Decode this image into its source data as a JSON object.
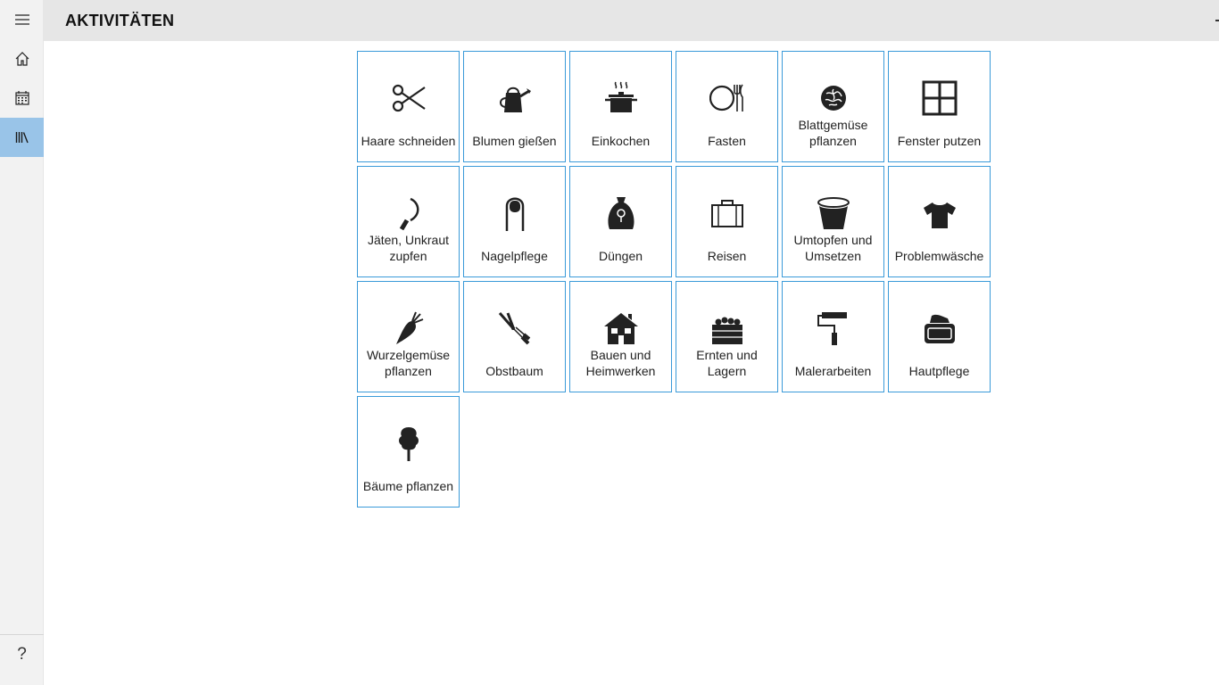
{
  "header": {
    "title": "AKTIVITÄTEN"
  },
  "nav": {
    "items": [
      {
        "name": "menu-icon"
      },
      {
        "name": "home-icon"
      },
      {
        "name": "calendar-icon"
      },
      {
        "name": "library-icon",
        "active": true
      }
    ],
    "help_label": "?"
  },
  "activities": [
    {
      "label": "Haare schneiden",
      "icon": "scissors-icon"
    },
    {
      "label": "Blumen gießen",
      "icon": "watering-can-icon"
    },
    {
      "label": "Einkochen",
      "icon": "cooking-pot-icon"
    },
    {
      "label": "Fasten",
      "icon": "plate-cutlery-icon"
    },
    {
      "label": "Blattgemüse pflanzen",
      "icon": "lettuce-icon"
    },
    {
      "label": "Fenster putzen",
      "icon": "window-icon"
    },
    {
      "label": "Jäten, Unkraut zupfen",
      "icon": "sickle-icon"
    },
    {
      "label": "Nagelpflege",
      "icon": "fingernail-icon"
    },
    {
      "label": "Düngen",
      "icon": "fertilizer-bag-icon"
    },
    {
      "label": "Reisen",
      "icon": "suitcase-icon"
    },
    {
      "label": "Umtopfen und Umsetzen",
      "icon": "flower-pot-icon"
    },
    {
      "label": "Problemwäsche",
      "icon": "tshirt-icon"
    },
    {
      "label": "Wurzelgemüse pflanzen",
      "icon": "carrot-icon"
    },
    {
      "label": "Obstbaum",
      "icon": "pruning-shears-icon"
    },
    {
      "label": "Bauen und Heimwerken",
      "icon": "house-icon"
    },
    {
      "label": "Ernten und Lagern",
      "icon": "harvest-crate-icon"
    },
    {
      "label": "Malerarbeiten",
      "icon": "paint-roller-icon"
    },
    {
      "label": "Hautpflege",
      "icon": "cream-jar-icon"
    },
    {
      "label": "Bäume pflanzen",
      "icon": "tree-icon"
    }
  ]
}
